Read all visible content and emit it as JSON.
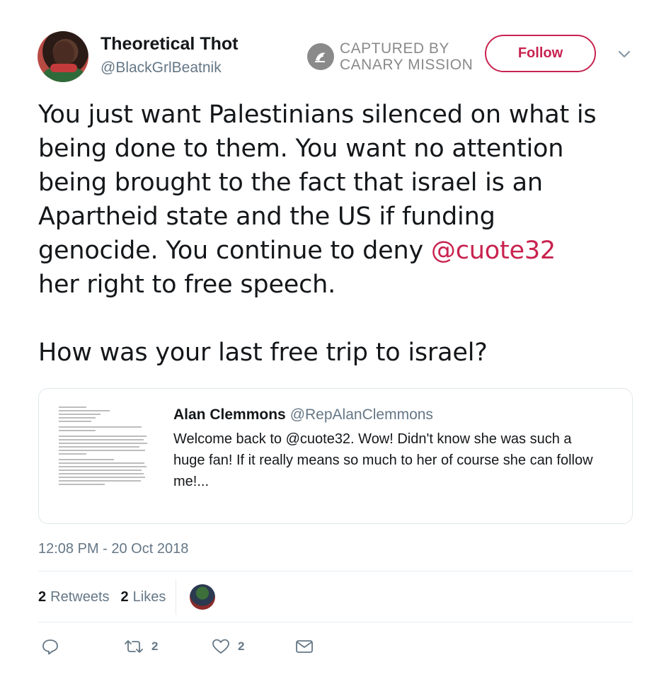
{
  "user": {
    "display_name": "Theoretical Thot",
    "handle": "@BlackGrlBeatnik"
  },
  "watermark": {
    "line1": "CAPTURED BY",
    "line2": "CANARY MISSION"
  },
  "follow_label": "Follow",
  "tweet": {
    "line1": "You just want Palestinians silenced on what is",
    "line2": "being done to them. You want no attention",
    "line3": "being brought to the fact that israel is an",
    "line4": "Apartheid state and the US if funding",
    "line5_pre": "genocide. You continue to deny ",
    "mention": "@cuote32",
    "line6": "her right to free speech.",
    "line7": "How was your last free trip to israel?"
  },
  "quote": {
    "name": "Alan Clemmons",
    "handle": "@RepAlanClemmons",
    "line1": "Welcome back to @cuote32. Wow!  Didn't know she was such a",
    "line2": "huge fan! If it really means so much to her of course she can follow",
    "line3": "me!..."
  },
  "timestamp": "12:08 PM - 20 Oct 2018",
  "stats": {
    "retweets_count": "2",
    "retweets_label": "Retweets",
    "likes_count": "2",
    "likes_label": "Likes"
  },
  "actions": {
    "retweet_count": "2",
    "like_count": "2"
  },
  "colors": {
    "accent": "#c8234f",
    "secondary_text": "#657786",
    "border": "#e1e8ed"
  },
  "icons": [
    "reply-icon",
    "retweet-icon",
    "heart-icon",
    "message-icon",
    "chevron-down-icon"
  ]
}
